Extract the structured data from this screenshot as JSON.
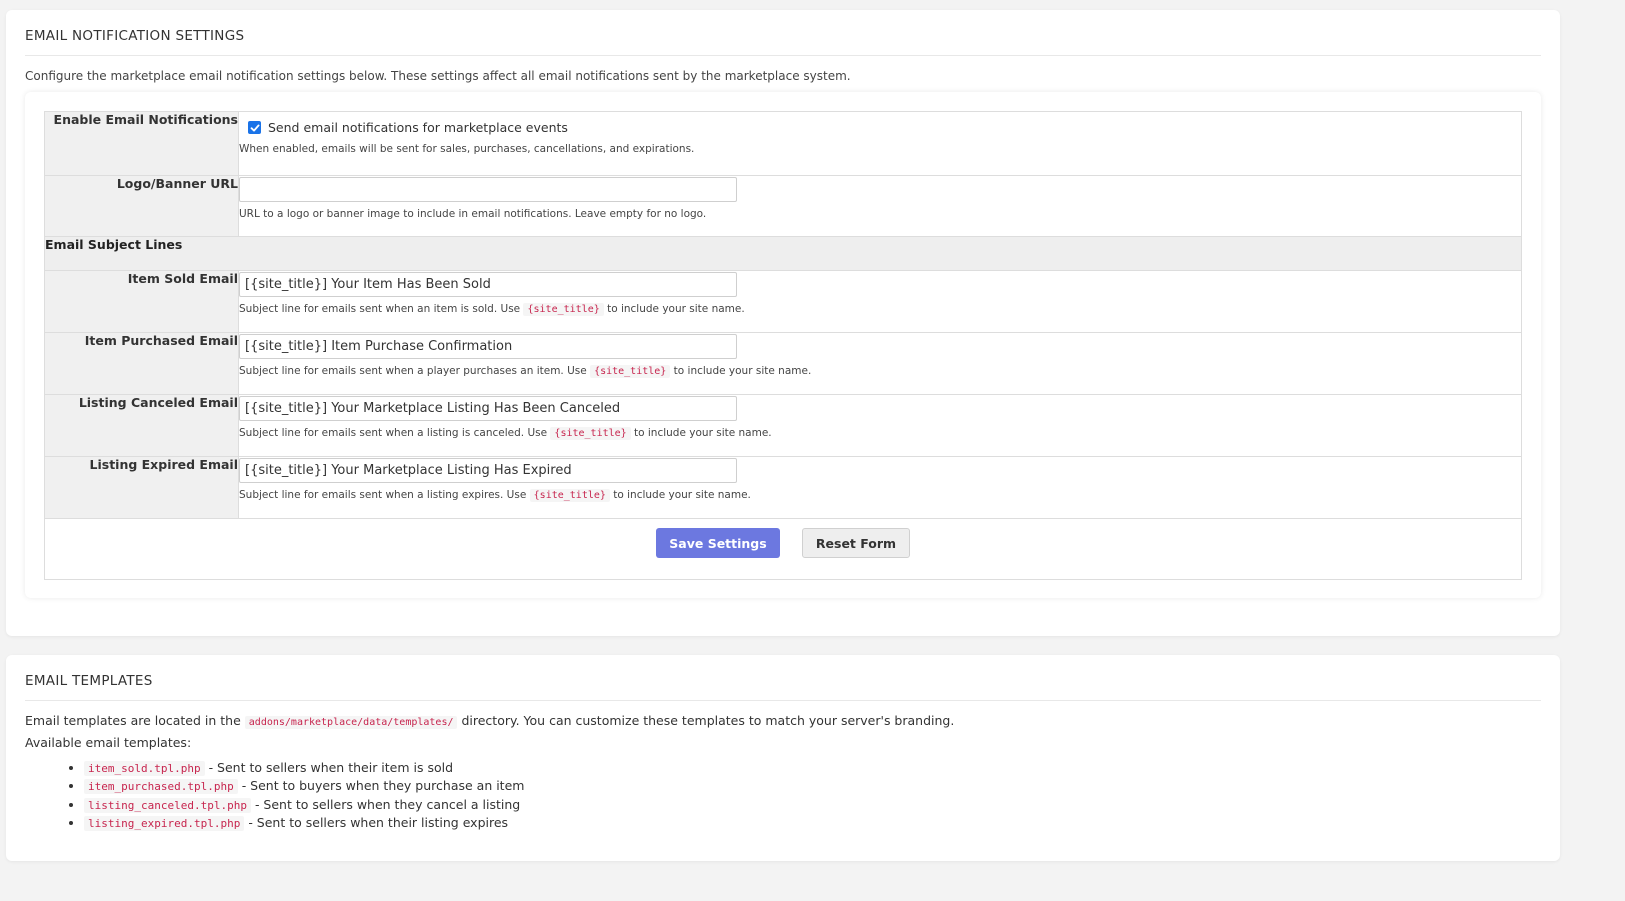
{
  "settings_panel": {
    "title": "EMAIL NOTIFICATION SETTINGS",
    "intro": "Configure the marketplace email notification settings below. These settings affect all email notifications sent by the marketplace system.",
    "enable": {
      "label": "Enable Email Notifications",
      "checkbox_label": "Send email notifications for marketplace events",
      "checked": true,
      "help": "When enabled, emails will be sent for sales, purchases, cancellations, and expirations."
    },
    "logo": {
      "label": "Logo/Banner URL",
      "value": "",
      "help": "URL to a logo or banner image to include in email notifications. Leave empty for no logo."
    },
    "subject_section_title": "Email Subject Lines",
    "subjects": [
      {
        "label": "Item Sold Email",
        "value": "[{site_title}] Your Item Has Been Sold",
        "help_before": "Subject line for emails sent when an item is sold. Use",
        "help_code": "{site_title}",
        "help_after": "to include your site name."
      },
      {
        "label": "Item Purchased Email",
        "value": "[{site_title}] Item Purchase Confirmation",
        "help_before": "Subject line for emails sent when a player purchases an item. Use",
        "help_code": "{site_title}",
        "help_after": "to include your site name."
      },
      {
        "label": "Listing Canceled Email",
        "value": "[{site_title}] Your Marketplace Listing Has Been Canceled",
        "help_before": "Subject line for emails sent when a listing is canceled. Use",
        "help_code": "{site_title}",
        "help_after": "to include your site name."
      },
      {
        "label": "Listing Expired Email",
        "value": "[{site_title}] Your Marketplace Listing Has Expired",
        "help_before": "Subject line for emails sent when a listing expires. Use",
        "help_code": "{site_title}",
        "help_after": "to include your site name."
      }
    ],
    "buttons": {
      "save": "Save Settings",
      "reset": "Reset Form"
    }
  },
  "templates_panel": {
    "title": "EMAIL TEMPLATES",
    "intro_before": "Email templates are located in the",
    "intro_code": "addons/marketplace/data/templates/",
    "intro_after": "directory. You can customize these templates to match your server's branding.",
    "available_label": "Available email templates:",
    "templates": [
      {
        "file": "item_sold.tpl.php",
        "desc": "- Sent to sellers when their item is sold"
      },
      {
        "file": "item_purchased.tpl.php",
        "desc": "- Sent to buyers when they purchase an item"
      },
      {
        "file": "listing_canceled.tpl.php",
        "desc": "- Sent to sellers when they cancel a listing"
      },
      {
        "file": "listing_expired.tpl.php",
        "desc": "- Sent to sellers when their listing expires"
      }
    ]
  },
  "colors": {
    "primary_button": "#6c78e0",
    "checkbox": "#1a73e8",
    "code_text": "#c7254e"
  },
  "icons": {
    "checkbox_checked": "checkmark-icon"
  }
}
